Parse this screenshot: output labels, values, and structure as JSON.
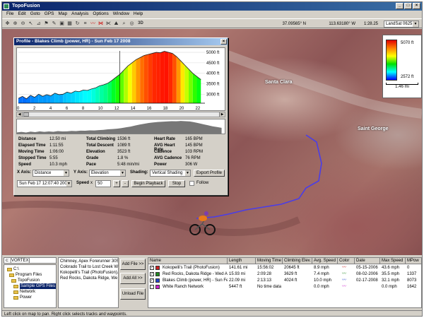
{
  "app": {
    "title": "TopoFusion",
    "menu": [
      "File",
      "Edit",
      "Goto",
      "GPS",
      "Map",
      "Analysis",
      "Options",
      "Window",
      "Help"
    ],
    "toolbar": {
      "lat": "37.09565° N",
      "lon": "113.63180° W",
      "zoom": "1:28.25",
      "map_source": "LandSat 0625",
      "threed_label": "3D"
    }
  },
  "map": {
    "labels": [
      "Santa Clara",
      "Saint George"
    ],
    "legend": {
      "top": "5070 ft",
      "bottom": "2572 ft",
      "scale": "1.46 mi"
    }
  },
  "profile": {
    "title": "Profile - Blakes Climb (power, HR) - Sun Feb 17 2008",
    "y_ticks": [
      "5000 ft",
      "4500 ft",
      "4000 ft",
      "3500 ft",
      "3000 ft"
    ],
    "x_ticks": [
      "0",
      "2",
      "4",
      "6",
      "8",
      "10",
      "12",
      "14",
      "16",
      "18",
      "20",
      "22"
    ],
    "stats": [
      {
        "k": "Distance",
        "v": "12.50 mi"
      },
      {
        "k": "Elapsed Time",
        "v": "1:11:55"
      },
      {
        "k": "Moving Time",
        "v": "1:06:00"
      },
      {
        "k": "Stopped Time",
        "v": "5:55"
      },
      {
        "k": "Speed",
        "v": "10.3 mph"
      },
      {
        "k": "Total Climbing",
        "v": "1536 ft"
      },
      {
        "k": "Total Descent",
        "v": "1089 ft"
      },
      {
        "k": "Elevation",
        "v": "3523 ft"
      },
      {
        "k": "Grade",
        "v": "1.8 %"
      },
      {
        "k": "Pace",
        "v": "5:48 min/mi"
      },
      {
        "k": "Heart Rate",
        "v": "165 BPM"
      },
      {
        "k": "AVG Heart Rate",
        "v": "145 BPM"
      },
      {
        "k": "Cadence",
        "v": "103 RPM"
      },
      {
        "k": "AVG Cadence",
        "v": "76 RPM"
      },
      {
        "k": "Power",
        "v": "306 W"
      }
    ],
    "x_axis_label": "X Axis:",
    "x_axis_value": "Distance",
    "y_axis_label": "Y Axis:",
    "y_axis_value": "Elevation",
    "shading_label": "Shading:",
    "shading_value": "Vertical Shading",
    "export_label": "Export Profile",
    "datetime": "Sun Feb 17 12:07:40 2008",
    "speed_label": "Speed",
    "speed_x": "x",
    "speed_value": "50",
    "plus": "+",
    "minus": "-",
    "playback_label": "Begin Playback",
    "stop_label": "Stop",
    "follow_label": "Follow"
  },
  "chart_data": {
    "type": "area",
    "title": "",
    "xlabel": "",
    "ylabel": "",
    "xlim": [
      0,
      23
    ],
    "ylim": [
      2572,
      5070
    ],
    "x": [
      0,
      0.5,
      1,
      1.5,
      2,
      2.5,
      3,
      3.5,
      4,
      4.5,
      5,
      5.5,
      6,
      6.5,
      7,
      7.5,
      8,
      8.5,
      9,
      9.5,
      10,
      10.5,
      11,
      11.5,
      12,
      12.5,
      13,
      13.5,
      14,
      14.5,
      15,
      15.5,
      16,
      16.5,
      17,
      17.5,
      18,
      18.5,
      19,
      19.5,
      20,
      20.5,
      21,
      21.5,
      22,
      22.5
    ],
    "series": [
      {
        "values": [
          2800,
          2900,
          2780,
          2950,
          2850,
          3000,
          2900,
          2980,
          2920,
          3050,
          2980,
          3000,
          3100,
          3050,
          3150,
          3120,
          3200,
          3180,
          3250,
          3300,
          3400,
          3450,
          3520,
          3650,
          3800,
          3950,
          4150,
          4350,
          4500,
          4650,
          4750,
          4850,
          4900,
          4950,
          5000,
          4980,
          5050,
          5000,
          4950,
          4800,
          4600,
          4400,
          4200,
          4000,
          3850,
          3700
        ]
      }
    ]
  },
  "bottom": {
    "drive": "c: [VORTEX]",
    "folders": [
      "C:\\",
      "Program Files",
      "TopoFusion",
      "Sample GPS Files",
      "Network",
      "Power"
    ],
    "files": [
      "Chimney, Apex Forerunner 305",
      "Colorado Trail to Lost Creek W",
      "Kokopelli's Trail (PhotoFusion).g",
      "Red Rocks, Dakota Ridge, We"
    ],
    "buttons": [
      "Add File >>",
      "Add All >>",
      "Unload File"
    ],
    "columns": [
      "Name",
      "Length",
      "Moving Time",
      "Climbing Elev.",
      "Avg. Speed",
      "Color",
      "Date",
      "Max Speed",
      "MPow"
    ],
    "rows": [
      {
        "name": "Kokopelli's Trail (PhotoFusion)",
        "length": "141.61 mi",
        "moving": "15:56:02",
        "climb": "20645 ft",
        "speed": "8.9 mph",
        "date": "05-15-2006",
        "max": "43.6 mph",
        "pow": "0",
        "color": "#cc2222",
        "checked": true
      },
      {
        "name": "Red Rocks, Dakota Ridge - Wed A...",
        "length": "15.93 mi",
        "moving": "2:09:28",
        "climb": "3629 ft",
        "speed": "7.4 mph",
        "date": "08-02-2006",
        "max": "35.5 mph",
        "pow": "1337",
        "color": "#228822",
        "checked": true
      },
      {
        "name": "Blakes Climb (power, HR) - Sun Feb...",
        "length": "22.09 mi",
        "moving": "2:13:13",
        "climb": "4024 ft",
        "speed": "10.0 mph",
        "date": "02-17-2008",
        "max": "32.1 mph",
        "pow": "8073",
        "color": "#2244cc",
        "checked": true
      },
      {
        "name": "White Ranch Network",
        "length": "5447 ft",
        "moving": "No time data",
        "climb": "",
        "speed": "0.0 mph",
        "date": "",
        "max": "0.0 mph",
        "pow": "1642",
        "color": "#cc22cc",
        "checked": false
      }
    ]
  },
  "status": "Left click on map to pan.  Right click selects tracks and waypoints."
}
